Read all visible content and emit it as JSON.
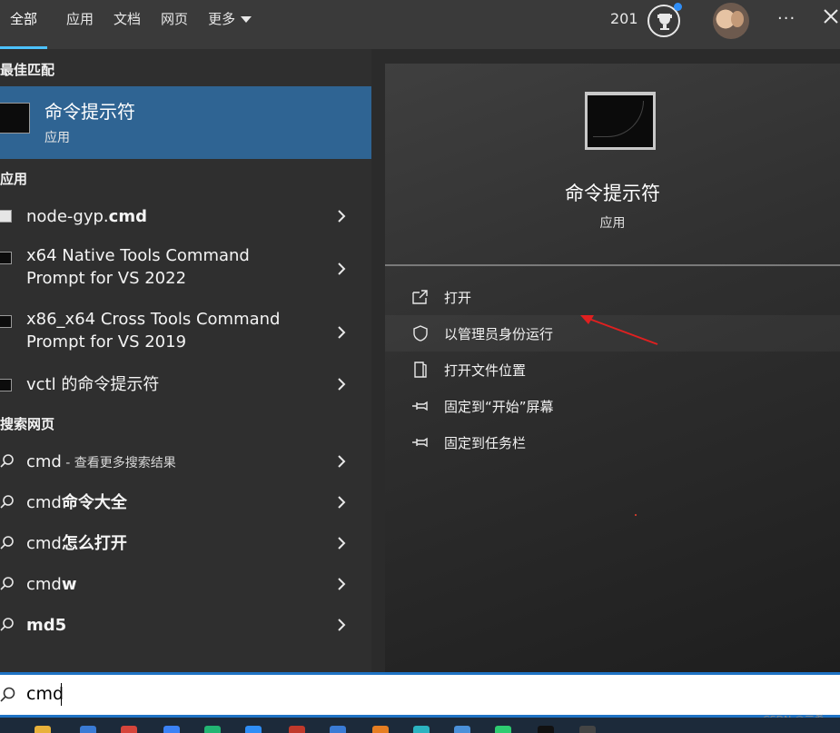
{
  "tabs": [
    {
      "label": "全部",
      "active": true
    },
    {
      "label": "应用"
    },
    {
      "label": "文档"
    },
    {
      "label": "网页"
    },
    {
      "label": "更多"
    }
  ],
  "header": {
    "points": "201",
    "more_glyph": "···"
  },
  "sections": {
    "best_match": "最佳匹配",
    "apps": "应用",
    "web": "搜索网页"
  },
  "best_match": {
    "title": "命令提示符",
    "subtitle": "应用"
  },
  "apps": [
    {
      "name": "node-gyp.",
      "name_bold": "cmd",
      "icon": "node-gyp-icon"
    },
    {
      "name_line1": "x64 Native Tools Command",
      "name_line2": "Prompt for VS 2022",
      "icon": "terminal-icon"
    },
    {
      "name_line1": "x86_x64 Cross Tools Command",
      "name_line2": "Prompt for VS 2019",
      "icon": "terminal-icon"
    },
    {
      "name": "vctl 的命令提示符",
      "icon": "terminal-icon"
    }
  ],
  "web_results": [
    {
      "query": "cmd",
      "hint": " - 查看更多搜索结果"
    },
    {
      "prefix": "cmd",
      "bold": "命令大全"
    },
    {
      "prefix": "cmd",
      "bold": "怎么打开"
    },
    {
      "prefix": "cmd",
      "bold": "w"
    },
    {
      "prefix": "md5",
      "bold": ""
    }
  ],
  "preview": {
    "title": "命令提示符",
    "subtitle": "应用",
    "actions": [
      {
        "label": "打开",
        "icon": "open-icon"
      },
      {
        "label": "以管理员身份运行",
        "icon": "shield-icon"
      },
      {
        "label": "打开文件位置",
        "icon": "folder-icon"
      },
      {
        "label": "固定到“开始”屏幕",
        "icon": "pin-icon"
      },
      {
        "label": "固定到任务栏",
        "icon": "pin-icon"
      }
    ]
  },
  "search": {
    "value": "cmd"
  },
  "watermark": "CSDN @三希",
  "colors": {
    "accent": "#4cc2ff",
    "selected": "#2f6493",
    "search_border": "#1f73c4",
    "annotation": "#e02020"
  }
}
